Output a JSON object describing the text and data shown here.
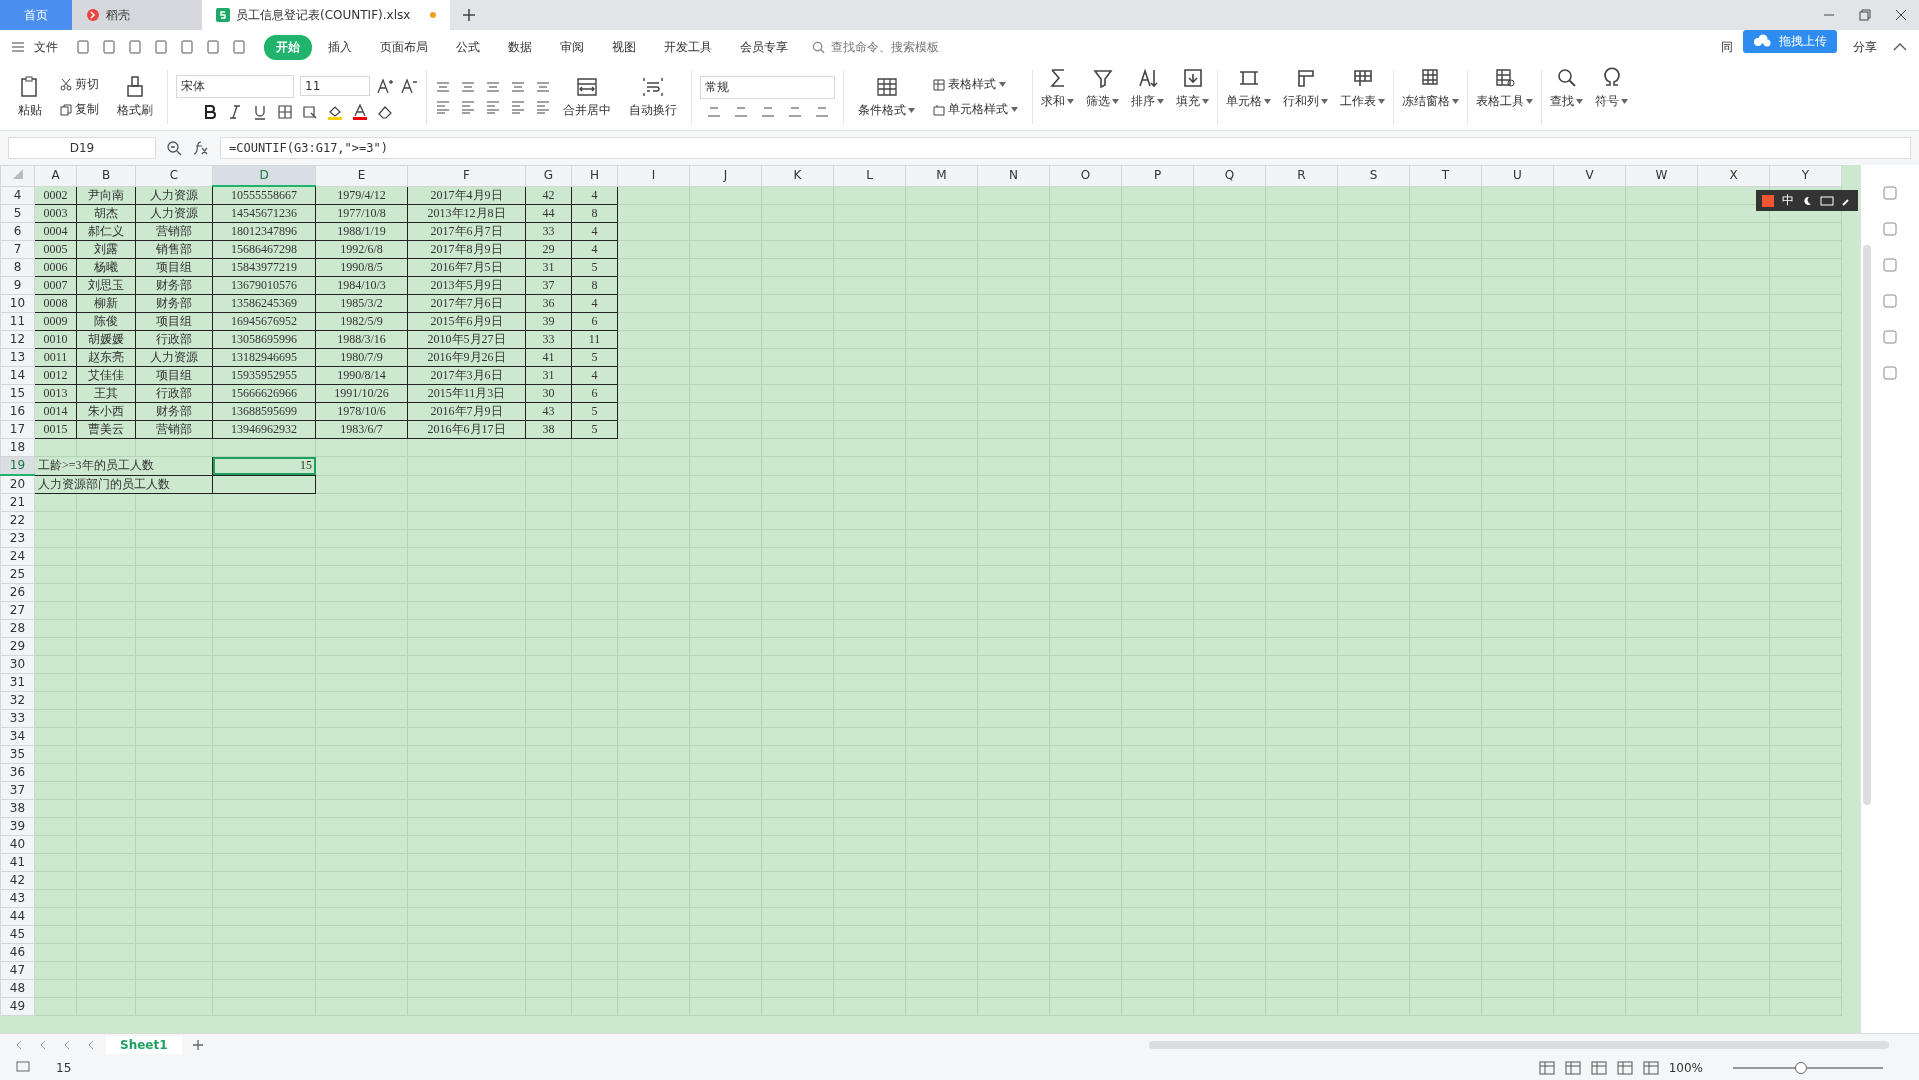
{
  "title_bar": {
    "tabs": [
      {
        "label": "首页",
        "kind": "home",
        "selected": false
      },
      {
        "label": "稻壳",
        "kind": "store",
        "selected": false
      },
      {
        "label": "员工信息登记表(COUNTIF).xlsx",
        "kind": "doc",
        "selected": true
      }
    ]
  },
  "menu": {
    "file": "文件",
    "tabs": [
      {
        "label": "开始",
        "selected": true
      },
      {
        "label": "插入",
        "selected": false
      },
      {
        "label": "页面布局",
        "selected": false
      },
      {
        "label": "公式",
        "selected": false
      },
      {
        "label": "数据",
        "selected": false
      },
      {
        "label": "审阅",
        "selected": false
      },
      {
        "label": "视图",
        "selected": false
      },
      {
        "label": "开发工具",
        "selected": false
      },
      {
        "label": "会员专享",
        "selected": false
      }
    ],
    "search": {
      "placeholder": "查找命令、搜索模板"
    },
    "sync": "同",
    "upload_tip": "拖拽上传",
    "share": "分享"
  },
  "ribbon": {
    "paste": "粘贴",
    "cut": "剪切",
    "copy": "复制",
    "format_painter": "格式刷",
    "font_name": "宋体",
    "font_size": "11",
    "merge": "合并居中",
    "wrap": "自动换行",
    "number_format": "常规",
    "conditional": "条件格式",
    "table_style": "表格样式",
    "cell_style": "单元格样式",
    "tools": [
      {
        "label": "求和"
      },
      {
        "label": "筛选"
      },
      {
        "label": "排序"
      },
      {
        "label": "填充"
      },
      {
        "label": "单元格"
      },
      {
        "label": "行和列"
      },
      {
        "label": "工作表"
      },
      {
        "label": "冻结窗格"
      },
      {
        "label": "表格工具"
      },
      {
        "label": "查找"
      },
      {
        "label": "符号"
      }
    ]
  },
  "formula_bar": {
    "cell": "D19",
    "formula": "=COUNTIF(G3:G17,\">=3\")"
  },
  "ime_bar": {
    "mode": "中"
  },
  "sheet": {
    "columns": [
      {
        "label": "A",
        "selected": false
      },
      {
        "label": "B",
        "selected": false
      },
      {
        "label": "C",
        "selected": false
      },
      {
        "label": "D",
        "selected": true
      },
      {
        "label": "E",
        "selected": false
      },
      {
        "label": "F",
        "selected": false
      },
      {
        "label": "G",
        "selected": false
      },
      {
        "label": "H",
        "selected": false
      },
      {
        "label": "I",
        "selected": false
      },
      {
        "label": "J",
        "selected": false
      },
      {
        "label": "K",
        "selected": false
      },
      {
        "label": "L",
        "selected": false
      },
      {
        "label": "M",
        "selected": false
      },
      {
        "label": "N",
        "selected": false
      },
      {
        "label": "O",
        "selected": false
      },
      {
        "label": "P",
        "selected": false
      },
      {
        "label": "Q",
        "selected": false
      },
      {
        "label": "R",
        "selected": false
      },
      {
        "label": "S",
        "selected": false
      },
      {
        "label": "T",
        "selected": false
      },
      {
        "label": "U",
        "selected": false
      },
      {
        "label": "V",
        "selected": false
      },
      {
        "label": "W",
        "selected": false
      },
      {
        "label": "X",
        "selected": false
      },
      {
        "label": "Y",
        "selected": false
      }
    ],
    "rows": [
      {
        "number": "4",
        "kind": "data",
        "cells": [
          "0002",
          "尹向南",
          "人力资源",
          "10555558667",
          "1979/4/12",
          "2017年4月9日",
          "42",
          "4"
        ]
      },
      {
        "number": "5",
        "kind": "data",
        "cells": [
          "0003",
          "胡杰",
          "人力资源",
          "14545671236",
          "1977/10/8",
          "2013年12月8日",
          "44",
          "8"
        ]
      },
      {
        "number": "6",
        "kind": "data",
        "cells": [
          "0004",
          "郝仁义",
          "营销部",
          "18012347896",
          "1988/1/19",
          "2017年6月7日",
          "33",
          "4"
        ]
      },
      {
        "number": "7",
        "kind": "data",
        "cells": [
          "0005",
          "刘露",
          "销售部",
          "15686467298",
          "1992/6/8",
          "2017年8月9日",
          "29",
          "4"
        ]
      },
      {
        "number": "8",
        "kind": "data",
        "cells": [
          "0006",
          "杨曦",
          "项目组",
          "15843977219",
          "1990/8/5",
          "2016年7月5日",
          "31",
          "5"
        ]
      },
      {
        "number": "9",
        "kind": "data",
        "cells": [
          "0007",
          "刘思玉",
          "财务部",
          "13679010576",
          "1984/10/3",
          "2013年5月9日",
          "37",
          "8"
        ]
      },
      {
        "number": "10",
        "kind": "data",
        "cells": [
          "0008",
          "柳新",
          "财务部",
          "13586245369",
          "1985/3/2",
          "2017年7月6日",
          "36",
          "4"
        ]
      },
      {
        "number": "11",
        "kind": "data",
        "cells": [
          "0009",
          "陈俊",
          "项目组",
          "16945676952",
          "1982/5/9",
          "2015年6月9日",
          "39",
          "6"
        ]
      },
      {
        "number": "12",
        "kind": "data",
        "cells": [
          "0010",
          "胡媛媛",
          "行政部",
          "13058695996",
          "1988/3/16",
          "2010年5月27日",
          "33",
          "11"
        ]
      },
      {
        "number": "13",
        "kind": "data",
        "cells": [
          "0011",
          "赵东亮",
          "人力资源",
          "13182946695",
          "1980/7/9",
          "2016年9月26日",
          "41",
          "5"
        ]
      },
      {
        "number": "14",
        "kind": "data",
        "cells": [
          "0012",
          "艾佳佳",
          "项目组",
          "15935952955",
          "1990/8/14",
          "2017年3月6日",
          "31",
          "4"
        ]
      },
      {
        "number": "15",
        "kind": "data",
        "cells": [
          "0013",
          "王其",
          "行政部",
          "15666626966",
          "1991/10/26",
          "2015年11月3日",
          "30",
          "6"
        ]
      },
      {
        "number": "16",
        "kind": "data",
        "cells": [
          "0014",
          "朱小西",
          "财务部",
          "13688595699",
          "1978/10/6",
          "2016年7月9日",
          "43",
          "5"
        ]
      },
      {
        "number": "17",
        "kind": "data",
        "cells": [
          "0015",
          "曹美云",
          "营销部",
          "13946962932",
          "1983/6/7",
          "2016年6月17日",
          "38",
          "5"
        ]
      },
      {
        "number": "18",
        "kind": "empty"
      },
      {
        "number": "19",
        "kind": "summary",
        "label": "工龄>=3年的员工人数",
        "value": "15",
        "selected": true
      },
      {
        "number": "20",
        "kind": "summary",
        "label": "人力资源部门的员工人数",
        "selected": false
      },
      {
        "number": "21",
        "kind": "empty"
      },
      {
        "number": "22",
        "kind": "empty"
      },
      {
        "number": "23",
        "kind": "empty"
      },
      {
        "number": "24",
        "kind": "empty"
      },
      {
        "number": "25",
        "kind": "empty"
      },
      {
        "number": "26",
        "kind": "empty"
      },
      {
        "number": "27",
        "kind": "empty"
      },
      {
        "number": "28",
        "kind": "empty"
      },
      {
        "number": "29",
        "kind": "empty"
      },
      {
        "number": "30",
        "kind": "empty"
      },
      {
        "number": "31",
        "kind": "empty"
      },
      {
        "number": "32",
        "kind": "empty"
      },
      {
        "number": "33",
        "kind": "empty"
      },
      {
        "number": "34",
        "kind": "empty"
      },
      {
        "number": "35",
        "kind": "empty"
      },
      {
        "number": "36",
        "kind": "empty"
      },
      {
        "number": "37",
        "kind": "empty"
      },
      {
        "number": "38",
        "kind": "empty"
      },
      {
        "number": "39",
        "kind": "empty"
      },
      {
        "number": "40",
        "kind": "empty"
      },
      {
        "number": "41",
        "kind": "empty"
      },
      {
        "number": "42",
        "kind": "empty"
      },
      {
        "number": "43",
        "kind": "empty"
      },
      {
        "number": "44",
        "kind": "empty"
      },
      {
        "number": "45",
        "kind": "empty"
      },
      {
        "number": "46",
        "kind": "empty"
      },
      {
        "number": "47",
        "kind": "empty"
      },
      {
        "number": "48",
        "kind": "empty"
      },
      {
        "number": "49",
        "kind": "empty"
      }
    ]
  },
  "sheet_tabs": [
    {
      "label": "Sheet1",
      "selected": true
    }
  ],
  "status_bar": {
    "sum": "15",
    "zoom": "100%",
    "zoom_slider": {
      "level": 0.45
    }
  }
}
